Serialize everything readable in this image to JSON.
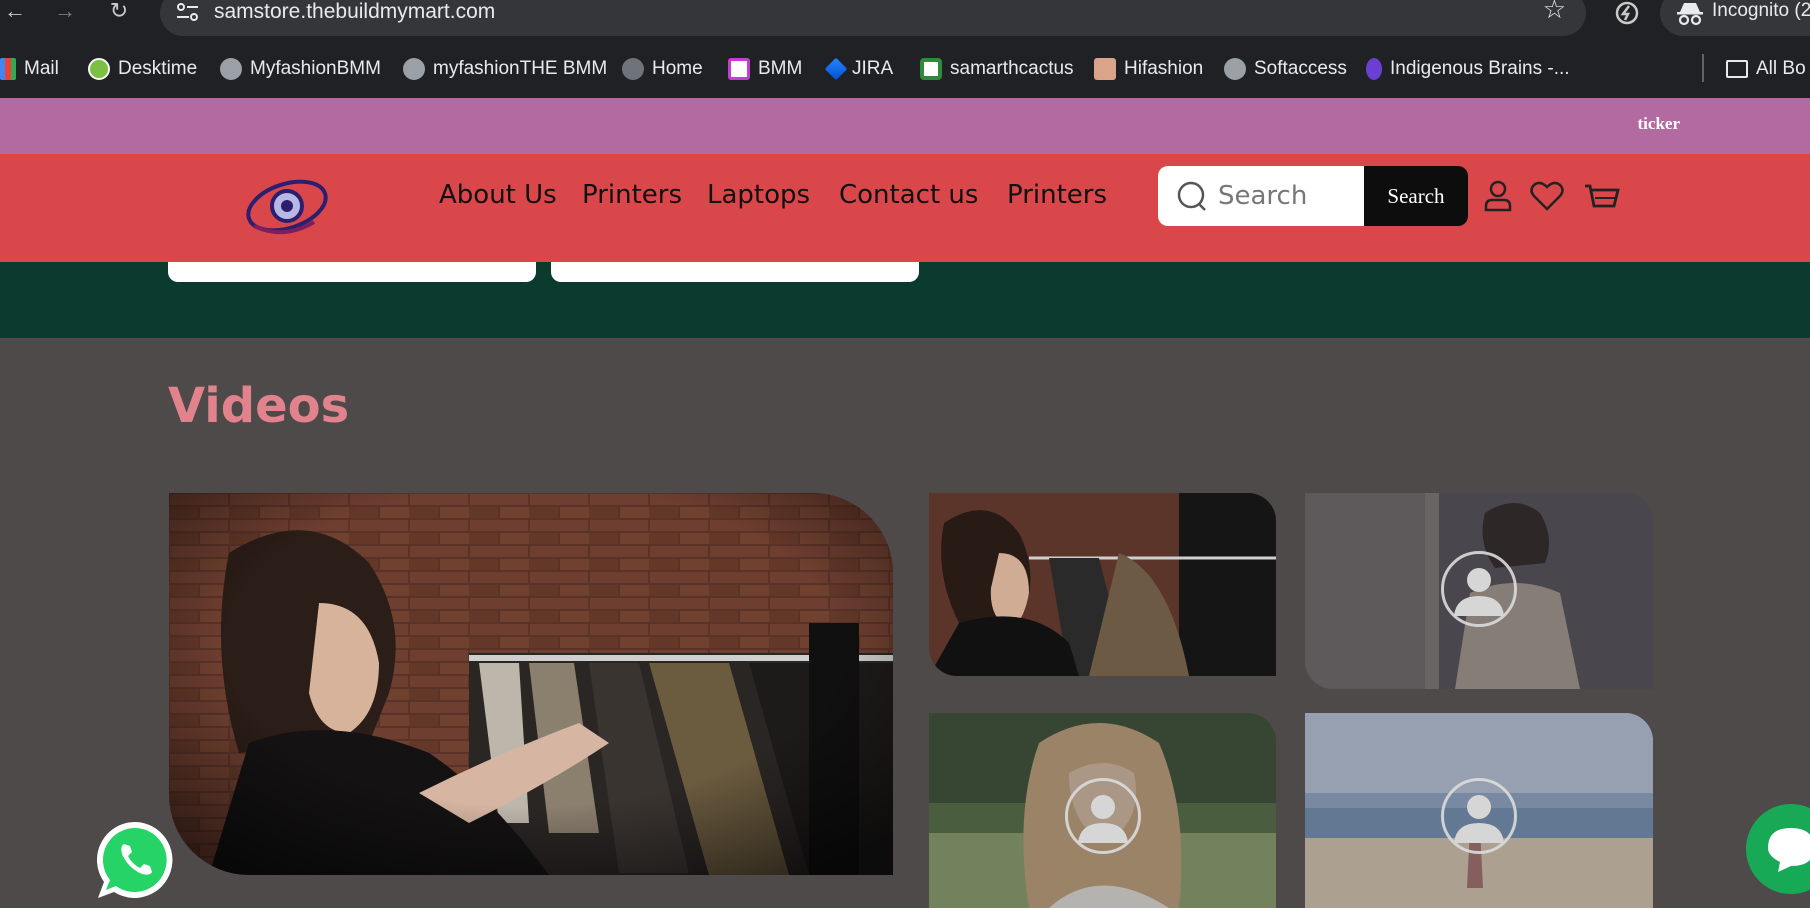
{
  "browser": {
    "url": "samstore.thebuildmymart.com",
    "incognito_label": "Incognito (2",
    "bookmarks": [
      "Mail",
      "Desktime",
      "MyfashionBMM",
      "myfashionTHE BMM",
      "Home",
      "BMM",
      "JIRA",
      "samarthcactus",
      "Hifashion",
      "Softaccess",
      "Indigenous Brains -...",
      "All Bo"
    ]
  },
  "ticker": {
    "text": "ticker"
  },
  "header": {
    "nav": [
      "About Us",
      "Printers",
      "Laptops",
      "Contact us",
      "Printers"
    ],
    "search_placeholder": "Search",
    "search_button": "Search"
  },
  "videos": {
    "title": "Videos"
  },
  "colors": {
    "ticker_bg": "#b36aa1",
    "header_bg": "#d9474a",
    "band_bg": "#0b3b2e",
    "page_bg": "#4f4a4a",
    "title_color": "#e1838d",
    "whatsapp": "#25d366"
  }
}
